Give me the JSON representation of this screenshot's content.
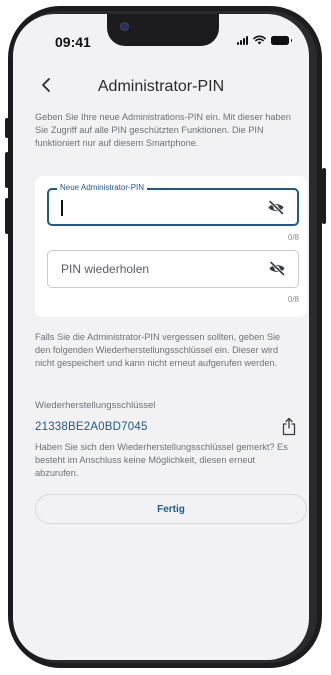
{
  "status": {
    "time": "09:41"
  },
  "header": {
    "title": "Administrator-PIN"
  },
  "intro": "Geben Sie Ihre neue Administrations-PIN ein. Mit dieser haben Sie Zugriff auf alle PIN geschützten Funktionen. Die PIN funktioniert nur auf diesem Smartphone.",
  "form": {
    "new_pin": {
      "label": "Neue Administrator-PIN",
      "value": "",
      "counter": "0/8"
    },
    "repeat_pin": {
      "placeholder": "PIN wiederholen",
      "value": "",
      "counter": "0/8"
    }
  },
  "recovery_info": "Falls Sie die Administrator-PIN vergessen sollten, geben Sie den folgenden Wiederherstellungsschlüssel ein. Dieser wird nicht gespeichert und kann nicht erneut aufgerufen werden.",
  "recovery": {
    "label": "Wiederherstellungsschlüssel",
    "key": "21338BE2A0BD7045"
  },
  "confirm_note": "Haben Sie sich den Wiederherstellungsschlüssel gemerkt? Es besteht im Anschluss keine Möglichkeit, diesen erneut abzurufen.",
  "actions": {
    "done_label": "Fertig"
  },
  "colors": {
    "accent": "#1e5a8c",
    "background": "#f2f2f4",
    "text_muted": "#6d7177"
  }
}
